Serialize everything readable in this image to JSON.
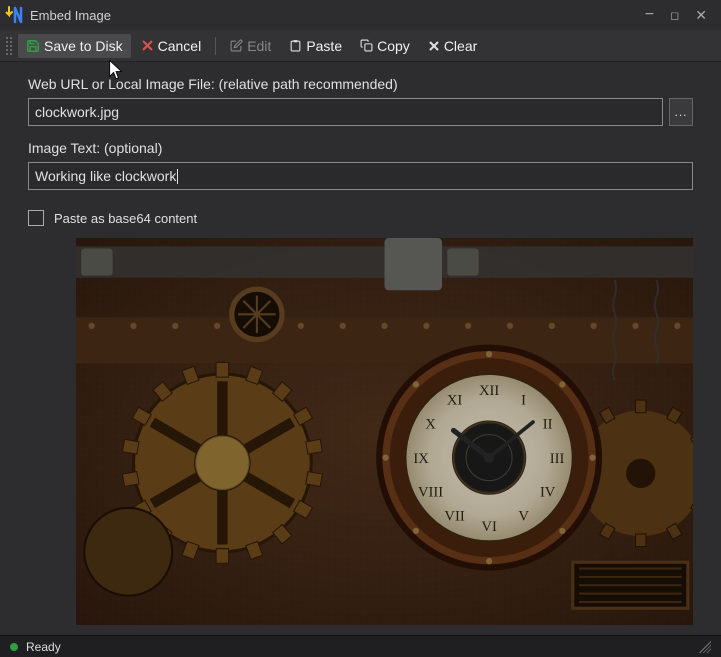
{
  "window": {
    "title": "Embed Image"
  },
  "toolbar": {
    "save_label": "Save to Disk",
    "cancel_label": "Cancel",
    "edit_label": "Edit",
    "paste_label": "Paste",
    "copy_label": "Copy",
    "clear_label": "Clear"
  },
  "form": {
    "url_label": "Web URL or Local Image File: (relative path recommended)",
    "url_value": "clockwork.jpg",
    "browse_label": "...",
    "text_label": "Image Text: (optional)",
    "text_value": "Working like clockwork",
    "base64_label": "Paste as base64 content"
  },
  "status": {
    "text": "Ready"
  },
  "colors": {
    "save_icon": "#2ea043",
    "cancel_icon": "#e05050",
    "clear_icon": "#d0d0d0"
  }
}
